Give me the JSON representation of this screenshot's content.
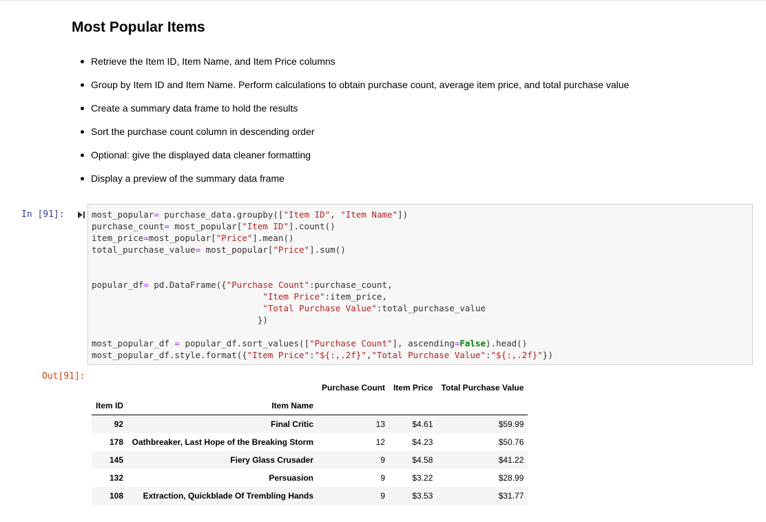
{
  "markdown": {
    "title": "Most Popular Items",
    "bullets": [
      "Retrieve the Item ID, Item Name, and Item Price columns",
      "Group by Item ID and Item Name. Perform calculations to obtain purchase count, average item price, and total purchase value",
      "Create a summary data frame to hold the results",
      "Sort the purchase count column in descending order",
      "Optional: give the displayed data cleaner formatting",
      "Display a preview of the summary data frame"
    ]
  },
  "cell": {
    "in_prompt": "In [91]:",
    "out_prompt": "Out[91]:"
  },
  "output_table": {
    "column_headers": [
      "Purchase Count",
      "Item Price",
      "Total Purchase Value"
    ],
    "index_headers": [
      "Item ID",
      "Item Name"
    ],
    "rows": [
      {
        "item_id": "92",
        "item_name": "Final Critic",
        "purchase_count": "13",
        "item_price": "$4.61",
        "total_value": "$59.99"
      },
      {
        "item_id": "178",
        "item_name": "Oathbreaker, Last Hope of the Breaking Storm",
        "purchase_count": "12",
        "item_price": "$4.23",
        "total_value": "$50.76"
      },
      {
        "item_id": "145",
        "item_name": "Fiery Glass Crusader",
        "purchase_count": "9",
        "item_price": "$4.58",
        "total_value": "$41.22"
      },
      {
        "item_id": "132",
        "item_name": "Persuasion",
        "purchase_count": "9",
        "item_price": "$3.22",
        "total_value": "$28.99"
      },
      {
        "item_id": "108",
        "item_name": "Extraction, Quickblade Of Trembling Hands",
        "purchase_count": "9",
        "item_price": "$3.53",
        "total_value": "$31.77"
      }
    ]
  },
  "icons": {
    "run": "run-cell-icon"
  },
  "colors": {
    "in_prompt": "#303f9f",
    "out_prompt": "#d84315",
    "string": "#ba2121",
    "keyword": "#008000"
  }
}
